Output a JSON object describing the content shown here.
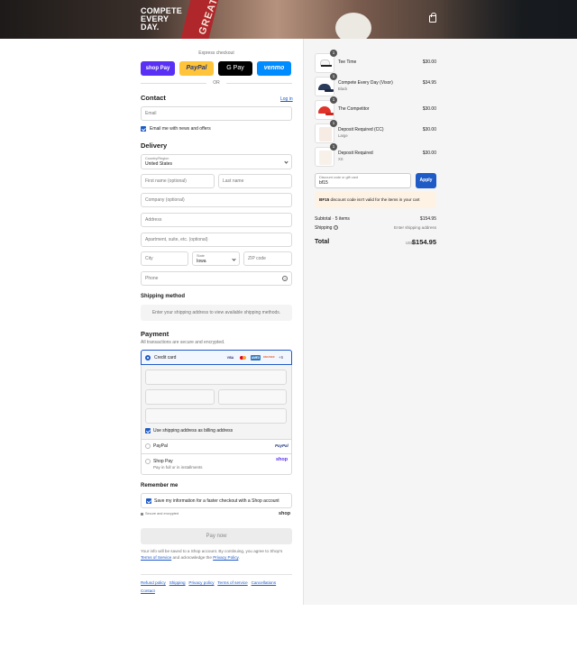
{
  "brand": {
    "logo_lines": [
      "COMPETE",
      "EVERY",
      "DAY."
    ],
    "logo_icon": "brand-logo",
    "cart_icon": "shopping-bag-icon",
    "wristband_text": "GREAT"
  },
  "colors": {
    "accent": "#1f5bc7",
    "shop_pay": "#5a31f4",
    "paypal": "#ffc439",
    "gpay": "#000000",
    "venmo": "#008cff",
    "header_bg": "#2a2321"
  },
  "express": {
    "label": "Express checkout",
    "buttons": [
      {
        "name": "shop-pay",
        "text": "shop Pay"
      },
      {
        "name": "paypal",
        "text": "PayPal"
      },
      {
        "name": "google-pay",
        "text": "G Pay"
      },
      {
        "name": "venmo",
        "text": "venmo"
      }
    ],
    "or_label": "OR"
  },
  "contact": {
    "title": "Contact",
    "login_link": "Log in",
    "email_placeholder": "Email",
    "news_label": "Email me with news and offers"
  },
  "delivery": {
    "title": "Delivery",
    "country_label": "Country/Region",
    "country_value": "United States",
    "first_name": "First name (optional)",
    "last_name": "Last name",
    "company": "Company (optional)",
    "address": "Address",
    "apartment": "Apartment, suite, etc. (optional)",
    "city": "City",
    "state_label": "State",
    "state_value": "Iowa",
    "zip": "ZIP code",
    "phone": "Phone"
  },
  "shipping_method": {
    "title": "Shipping method",
    "notice": "Enter your shipping address to view available shipping methods."
  },
  "payment": {
    "title": "Payment",
    "subtitle": "All transactions are secure and encrypted.",
    "credit_card_label": "Credit card",
    "card_brands": [
      "VISA",
      "MC",
      "AMEX",
      "DISCOVER"
    ],
    "card_more": "+5",
    "billing_label": "Use shipping address as billing address",
    "paypal_label": "PayPal",
    "paypal_logo": "PayPal",
    "shoppay_label": "Shop Pay",
    "shoppay_sub": "Pay in full or in installments",
    "shoppay_logo": "shop"
  },
  "remember": {
    "title": "Remember me",
    "save_label": "Save my information for a faster checkout with a Shop account",
    "secure_label": "Secure and encrypted",
    "shop_logo": "shop"
  },
  "pay_now_label": "Pay now",
  "legal": {
    "text_before": "Your info will be saved to a Shop account. By continuing, you agree to Shop's",
    "terms_link": "Terms of Service",
    "text_mid": "and acknowledge the",
    "privacy_link": "Privacy Policy",
    "text_end": "."
  },
  "footer_links": [
    "Refund policy",
    "Shipping",
    "Privacy policy",
    "Terms of service",
    "Cancellations",
    "Contact"
  ],
  "cart": {
    "items": [
      {
        "name": "Tee Time",
        "variant": "",
        "price": "$30.00",
        "qty": "1"
      },
      {
        "name": "Compete Every Day (Visor)",
        "variant": "Black",
        "price": "$34.95",
        "qty": "1"
      },
      {
        "name": "The Competitor",
        "variant": "",
        "price": "$30.00",
        "qty": "1"
      },
      {
        "name": "Deposit Required (CC)",
        "variant": "Large",
        "price": "$30.00",
        "qty": "1"
      },
      {
        "name": "Deposit Required",
        "variant": "XS",
        "price": "$30.00",
        "qty": "1"
      }
    ],
    "discount_label": "Discount code or gift card",
    "discount_value": "bf15",
    "apply_label": "Apply",
    "error_code": "BF15",
    "error_text": "discount code isn't valid for the items in your cart",
    "subtotal_label": "Subtotal · 5 items",
    "subtotal_value": "$154.95",
    "shipping_label": "Shipping",
    "shipping_value": "Enter shipping address",
    "total_label": "Total",
    "currency": "USD",
    "total_value": "$154.95"
  }
}
